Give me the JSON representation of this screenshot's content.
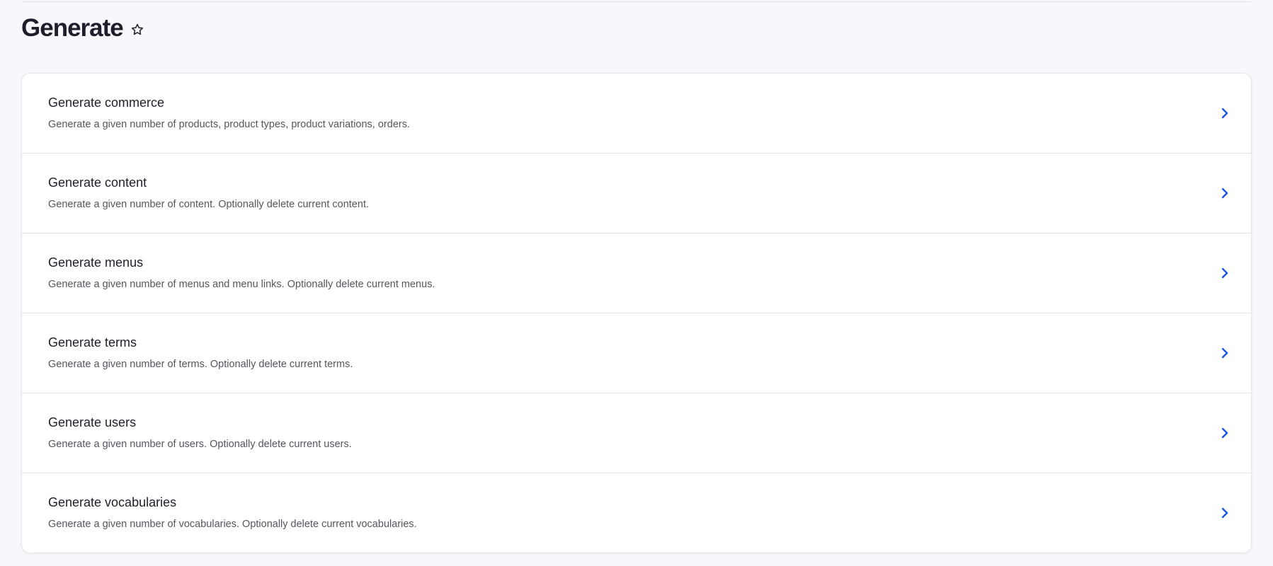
{
  "page": {
    "title": "Generate"
  },
  "items": [
    {
      "title": "Generate commerce",
      "description": "Generate a given number of products, product types, product variations, orders."
    },
    {
      "title": "Generate content",
      "description": "Generate a given number of content. Optionally delete current content."
    },
    {
      "title": "Generate menus",
      "description": "Generate a given number of menus and menu links. Optionally delete current menus."
    },
    {
      "title": "Generate terms",
      "description": "Generate a given number of terms. Optionally delete current terms."
    },
    {
      "title": "Generate users",
      "description": "Generate a given number of users. Optionally delete current users."
    },
    {
      "title": "Generate vocabularies",
      "description": "Generate a given number of vocabularies. Optionally delete current vocabularies."
    }
  ],
  "colors": {
    "accent": "#1b54e8",
    "text": "#1f1f2b",
    "background": "#f7f8fc"
  }
}
